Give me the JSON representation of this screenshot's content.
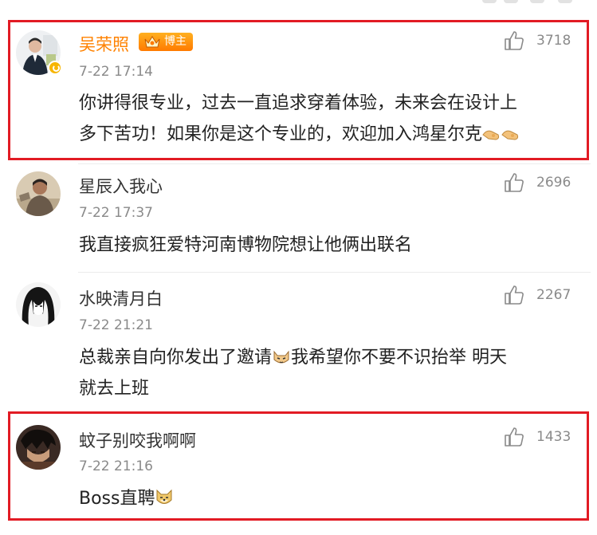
{
  "comments": [
    {
      "username": "吴荣照",
      "badge": "博主",
      "timestamp": "7-22 17:14",
      "text_line1": "你讲得很专业，过去一直追求穿着体验，未来会在设计上",
      "text_line2": "多下苦功！如果你是这个专业的，欢迎加入鸿星尔克",
      "emoji": "handshake-icon",
      "likes": "3718",
      "highlighted": true
    },
    {
      "username": "星辰入我心",
      "timestamp": "7-22 17:37",
      "text_line1": "我直接疯狂爱特河南博物院想让他俩出联名",
      "likes": "2696"
    },
    {
      "username": "水映清月白",
      "timestamp": "7-22 21:21",
      "text_line1a": "总裁亲自向你发出了邀请",
      "emoji": "cat-icon",
      "text_line1b": "我希望你不要不识抬举 明天",
      "text_line2": "就去上班",
      "likes": "2267"
    },
    {
      "username": "蚊子别咬我啊啊",
      "timestamp": "7-22 21:16",
      "text_line1": "Boss直聘",
      "emoji": "dog-icon",
      "likes": "1433",
      "highlighted": true
    }
  ],
  "colors": {
    "highlight_border": "#e21b24",
    "vip_name": "#ff8200",
    "muted_text": "#8a8a8a",
    "badge_gradient": [
      "#ffb020",
      "#ff7a00"
    ]
  }
}
